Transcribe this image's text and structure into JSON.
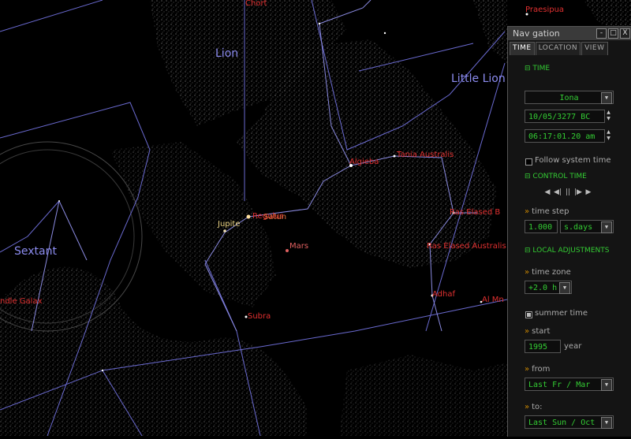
{
  "sky": {
    "constellations": [
      {
        "id": "lion",
        "name": "Lion"
      },
      {
        "id": "little-lion",
        "name": "Little Lion"
      },
      {
        "id": "sextant",
        "name": "Sextant"
      }
    ],
    "stars": [
      {
        "id": "chort",
        "name": "Chort"
      },
      {
        "id": "praesipua",
        "name": "Praesipua"
      },
      {
        "id": "algieba",
        "name": "Algieba"
      },
      {
        "id": "tania-australis",
        "name": "Tania Australis"
      },
      {
        "id": "ras-elased-borealis",
        "name": "Ras Elased B"
      },
      {
        "id": "ras-elased-australis",
        "name": "Ras Elased Australis"
      },
      {
        "id": "adhafera",
        "name": "Adhaf"
      },
      {
        "id": "al-minliar",
        "name": "Al Mn"
      },
      {
        "id": "regulus",
        "name": "Regulus"
      },
      {
        "id": "subra",
        "name": "Subra"
      },
      {
        "id": "spindle-galaxy",
        "name": "ndle Galax"
      }
    ],
    "planets": [
      {
        "id": "jupiter",
        "name": "Jupite"
      },
      {
        "id": "saturn",
        "name": "Satun"
      },
      {
        "id": "mars",
        "name": "Mars"
      }
    ]
  },
  "nav": {
    "title": "Nav gation",
    "controls": {
      "minimize": "-",
      "restore": "□",
      "close": "X"
    },
    "tabs": [
      "TIME",
      "LOCATION",
      "VIEW"
    ],
    "time_section": "TIME",
    "calendar": "Iona",
    "date": "10/05/3277 BC",
    "clock": "06:17:01.20 am",
    "follow_label": "Follow system time",
    "control_section": "CONTROL TIME",
    "time_control_icons": [
      "◀",
      "◀|",
      "||",
      "|▶",
      "▶"
    ],
    "time_step_label": "time step",
    "time_step_value": "1.000",
    "time_step_unit": "s.days",
    "local_section": "LOCAL ADJUSTMENTS",
    "tz_label": "time zone",
    "tz_value": "+2.0 h",
    "summer_label": "summer time",
    "start_label": "start",
    "start_year": "1995",
    "year_label": "year",
    "from_label": "from",
    "from_value": "Last  Fr / Mar",
    "to_label": "to:",
    "to_value": "Last  Sun / Oct",
    "arrow": "»",
    "dropdown_glyph": "▼",
    "spin_up": "▲",
    "spin_down": "▼"
  },
  "colors": {
    "background": "#000000",
    "constellation_line": "#7070d0",
    "constellation_label": "#8c8cf0",
    "star_label": "#e03030",
    "section_green": "#33cc33",
    "label_orange": "#cc8800"
  }
}
